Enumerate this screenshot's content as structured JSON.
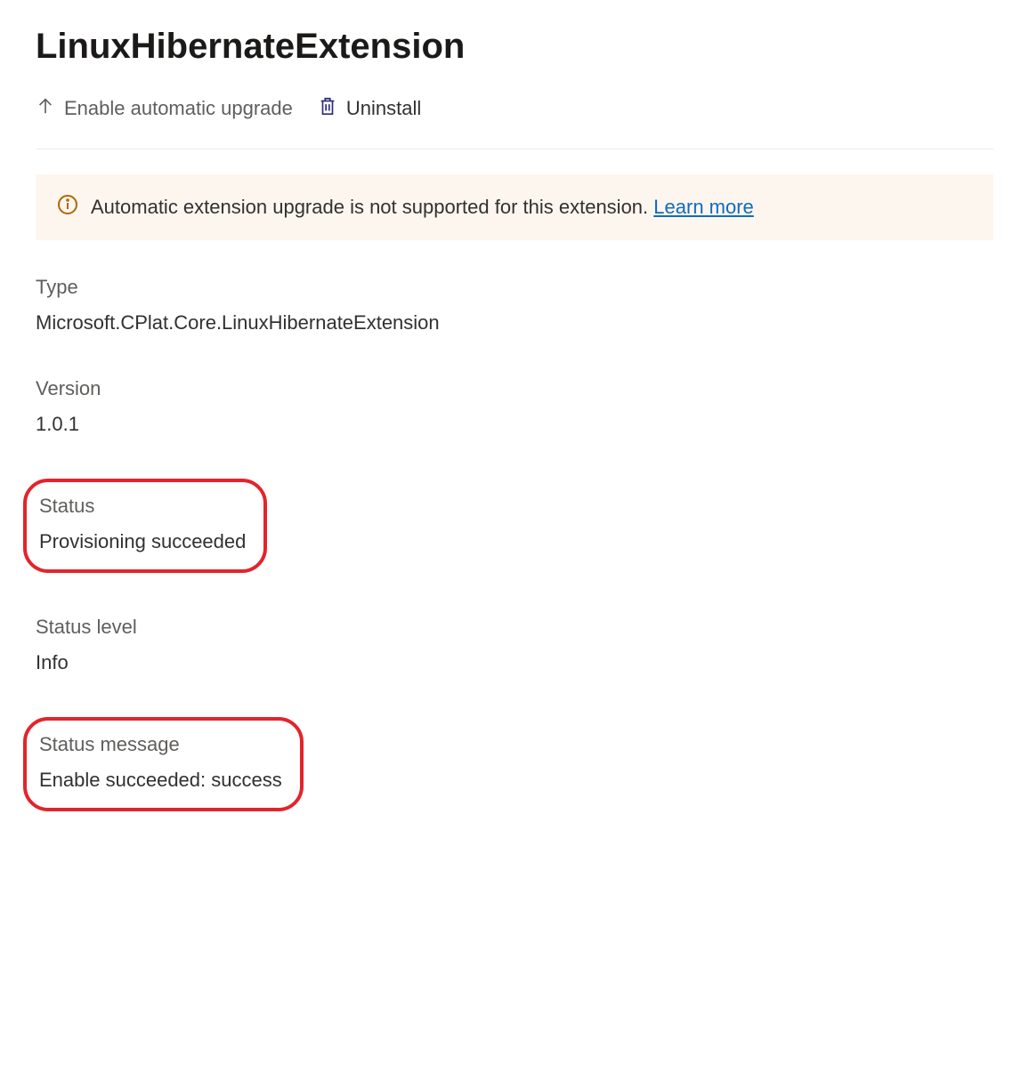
{
  "page": {
    "title": "LinuxHibernateExtension"
  },
  "toolbar": {
    "enable_upgrade_label": "Enable automatic upgrade",
    "uninstall_label": "Uninstall"
  },
  "banner": {
    "message": "Automatic extension upgrade is not supported for this extension.",
    "link_label": "Learn more"
  },
  "fields": {
    "type": {
      "label": "Type",
      "value": "Microsoft.CPlat.Core.LinuxHibernateExtension"
    },
    "version": {
      "label": "Version",
      "value": "1.0.1"
    },
    "status": {
      "label": "Status",
      "value": "Provisioning succeeded"
    },
    "status_level": {
      "label": "Status level",
      "value": "Info"
    },
    "status_message": {
      "label": "Status message",
      "value": "Enable succeeded: success"
    }
  }
}
